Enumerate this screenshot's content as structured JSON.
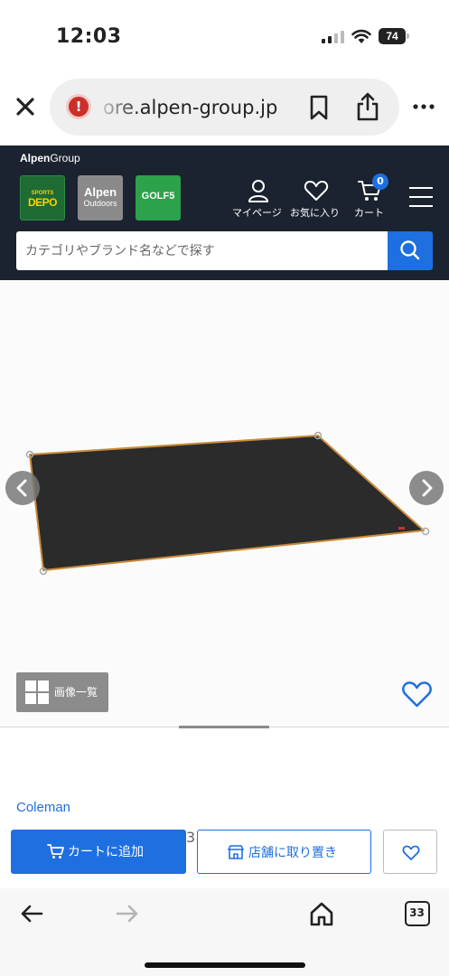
{
  "status_bar": {
    "time": "12:03",
    "battery": "74"
  },
  "browser": {
    "url": "ore.alpen-group.jp",
    "tab_count": "33"
  },
  "site_header": {
    "group_logo_bold": "Alpen",
    "group_logo_rest": "Group",
    "brands": {
      "depo_line1": "SPORTS",
      "depo_line2": "DEPO",
      "alpen_line1": "Alpen",
      "alpen_line2": "Outdoors",
      "golf5": "GOLF5"
    },
    "nav": {
      "mypage": "マイページ",
      "favorites": "お気に入り",
      "cart": "カート",
      "cart_count": "0"
    },
    "search": {
      "placeholder": "カテゴリやブランド名などで探す"
    }
  },
  "gallery": {
    "image_list_label": "画像一覧",
    "mat_color": "#2b2b2b",
    "edge_color": "#c98a3a"
  },
  "product": {
    "brand": "Coleman",
    "stray_text": "3"
  },
  "actions": {
    "add_to_cart": "カートに追加",
    "store_pickup": "店舗に取り置き"
  },
  "colors": {
    "accent": "#1e6fe0",
    "header_bg": "#1b2330"
  }
}
